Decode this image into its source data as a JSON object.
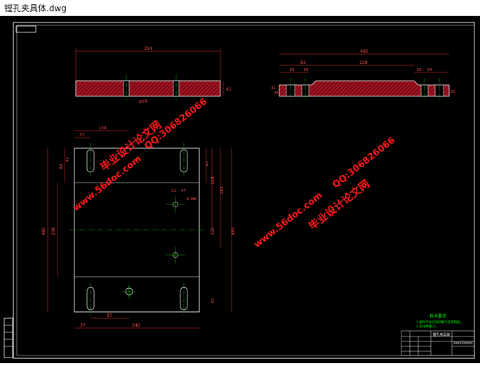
{
  "window": {
    "title": "镗孔夹具体.dwg"
  },
  "drawing": {
    "colors": {
      "background": "#000000",
      "frame": "#ffffff",
      "hatch": "#c8102e",
      "dim": "#ff3030",
      "center": "#00c000",
      "note": "#00ff00",
      "watermark": "#ff1a1a"
    },
    "top_view": {
      "width": "314",
      "thickness": "41",
      "hole": "φ18"
    },
    "side_view": {
      "width": "485",
      "d1": "83",
      "d2": "33",
      "d3": "34",
      "d4": "228",
      "d5": "25",
      "d6": "34",
      "h1": "41",
      "h2": "25",
      "h3": "25"
    },
    "plan_view": {
      "w1": "37",
      "w2": "134",
      "h_top": "84",
      "h_small": "47",
      "r21": "21",
      "r47": "47",
      "thread": "6-M8",
      "h_left1": "485",
      "h_left2": "238",
      "h_right1": "328",
      "h_right2": "283",
      "h_right3": "485",
      "h_right4": "330",
      "h_bottom": "47",
      "b1": "37",
      "b2": "97",
      "b3": "240"
    },
    "watermarks": [
      "毕业设计论文网",
      "QQ:306826066",
      "www.56doc.com",
      "毕业设计论文网",
      "QQ:306826066",
      "www.56doc.com"
    ],
    "notes": {
      "title": "技术要求",
      "line1": "1.铸件不允许有砂眼气孔等缺陷。",
      "line2": "2.未注倒角C1。"
    },
    "title_block": {
      "name": "镗孔夹具体",
      "code": "XXXXXXXXXX"
    }
  }
}
